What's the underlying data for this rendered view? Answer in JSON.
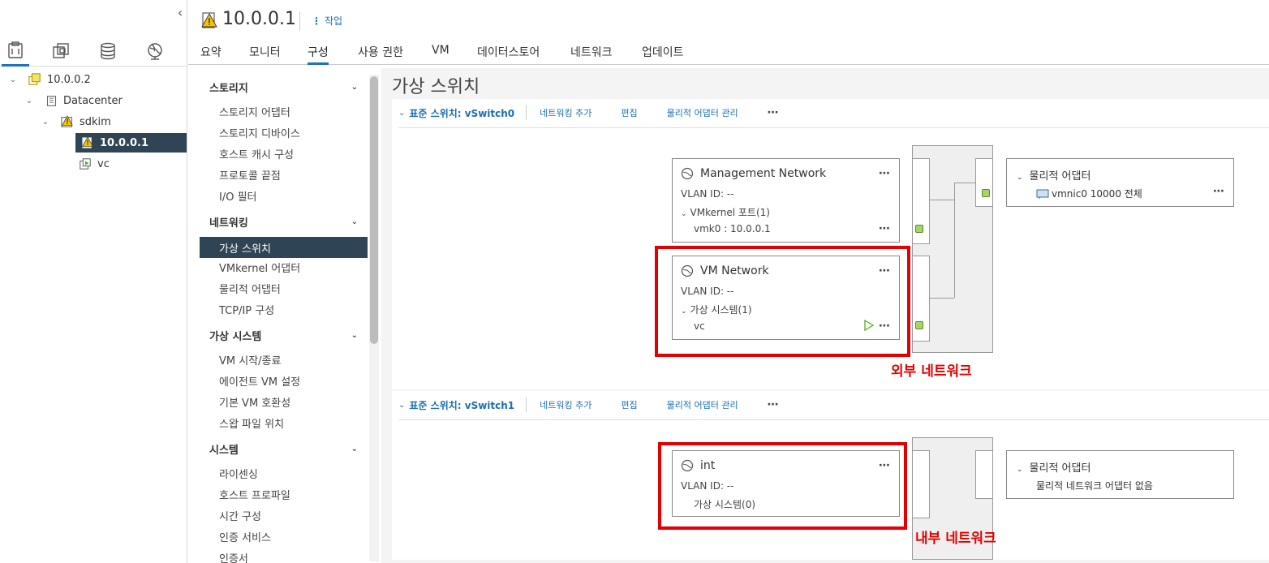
{
  "left_panel": {
    "nav_tabs": [
      "hosts-and-clusters-icon",
      "vms-and-templates-icon",
      "storage-icon",
      "networking-icon"
    ],
    "tree": [
      {
        "label": "10.0.0.2",
        "icon": "vcenter-icon"
      },
      {
        "label": "Datacenter",
        "icon": "datacenter-icon"
      },
      {
        "label": "sdkim",
        "icon": "cluster-warning-icon"
      },
      {
        "label": "10.0.0.1",
        "icon": "host-warning-icon"
      },
      {
        "label": "vc",
        "icon": "vm-running-icon"
      }
    ]
  },
  "header": {
    "host_title": "10.0.0.1",
    "actions_label": "작업",
    "tabs": [
      "요약",
      "모니터",
      "구성",
      "사용 권한",
      "VM",
      "데이터스토어",
      "네트워크",
      "업데이트"
    ],
    "active_tab": "구성"
  },
  "menu": {
    "groups": [
      {
        "label": "스토리지",
        "items": [
          "스토리지 어댑터",
          "스토리지 디바이스",
          "호스트 캐시 구성",
          "프로토콜 끝점",
          "I/O 필터"
        ]
      },
      {
        "label": "네트워킹",
        "items": [
          "가상 스위치",
          "VMkernel 어댑터",
          "물리적 어댑터",
          "TCP/IP 구성"
        ]
      },
      {
        "label": "가상 시스템",
        "items": [
          "VM 시작/종료",
          "에이전트 VM 설정",
          "기본 VM 호환성",
          "스왑 파일 위치"
        ]
      },
      {
        "label": "시스템",
        "items": [
          "라이센싱",
          "호스트 프로파일",
          "시간 구성",
          "인증 서비스",
          "인증서"
        ]
      }
    ],
    "selected": "가상 스위치"
  },
  "content": {
    "page_title": "가상 스위치",
    "switches": [
      {
        "title": "표준 스위치: vSwitch0",
        "actions": [
          "네트워킹 추가",
          "편집",
          "물리적 어댑터 관리"
        ],
        "port_groups": [
          {
            "name": "Management Network",
            "vlan": "VLAN ID: --",
            "sub_title": "VMkernel 포트(1)",
            "sub_item": "vmk0 : 10.0.0.1"
          },
          {
            "name": "VM Network",
            "vlan": "VLAN ID: --",
            "sub_title": "가상 시스템(1)",
            "sub_item": "vc"
          }
        ],
        "physical": {
          "title": "물리적 어댑터",
          "item": "vmnic0 10000 전체"
        },
        "annotation": "외부 네트워크"
      },
      {
        "title": "표준 스위치: vSwitch1",
        "actions": [
          "네트워킹 추가",
          "편집",
          "물리적 어댑터 관리"
        ],
        "port_groups": [
          {
            "name": "int",
            "vlan": "VLAN ID: --",
            "sub_title": "가상 시스템(0)"
          }
        ],
        "physical": {
          "title": "물리적 어댑터",
          "item": "물리적 네트워크 어댑터 없음"
        },
        "annotation": "내부 네트워크"
      }
    ]
  },
  "colors": {
    "accent": "#1b75bb",
    "selected_bg": "#2f4454",
    "annotation": "#e40000",
    "port_green": "#a6d46c"
  }
}
